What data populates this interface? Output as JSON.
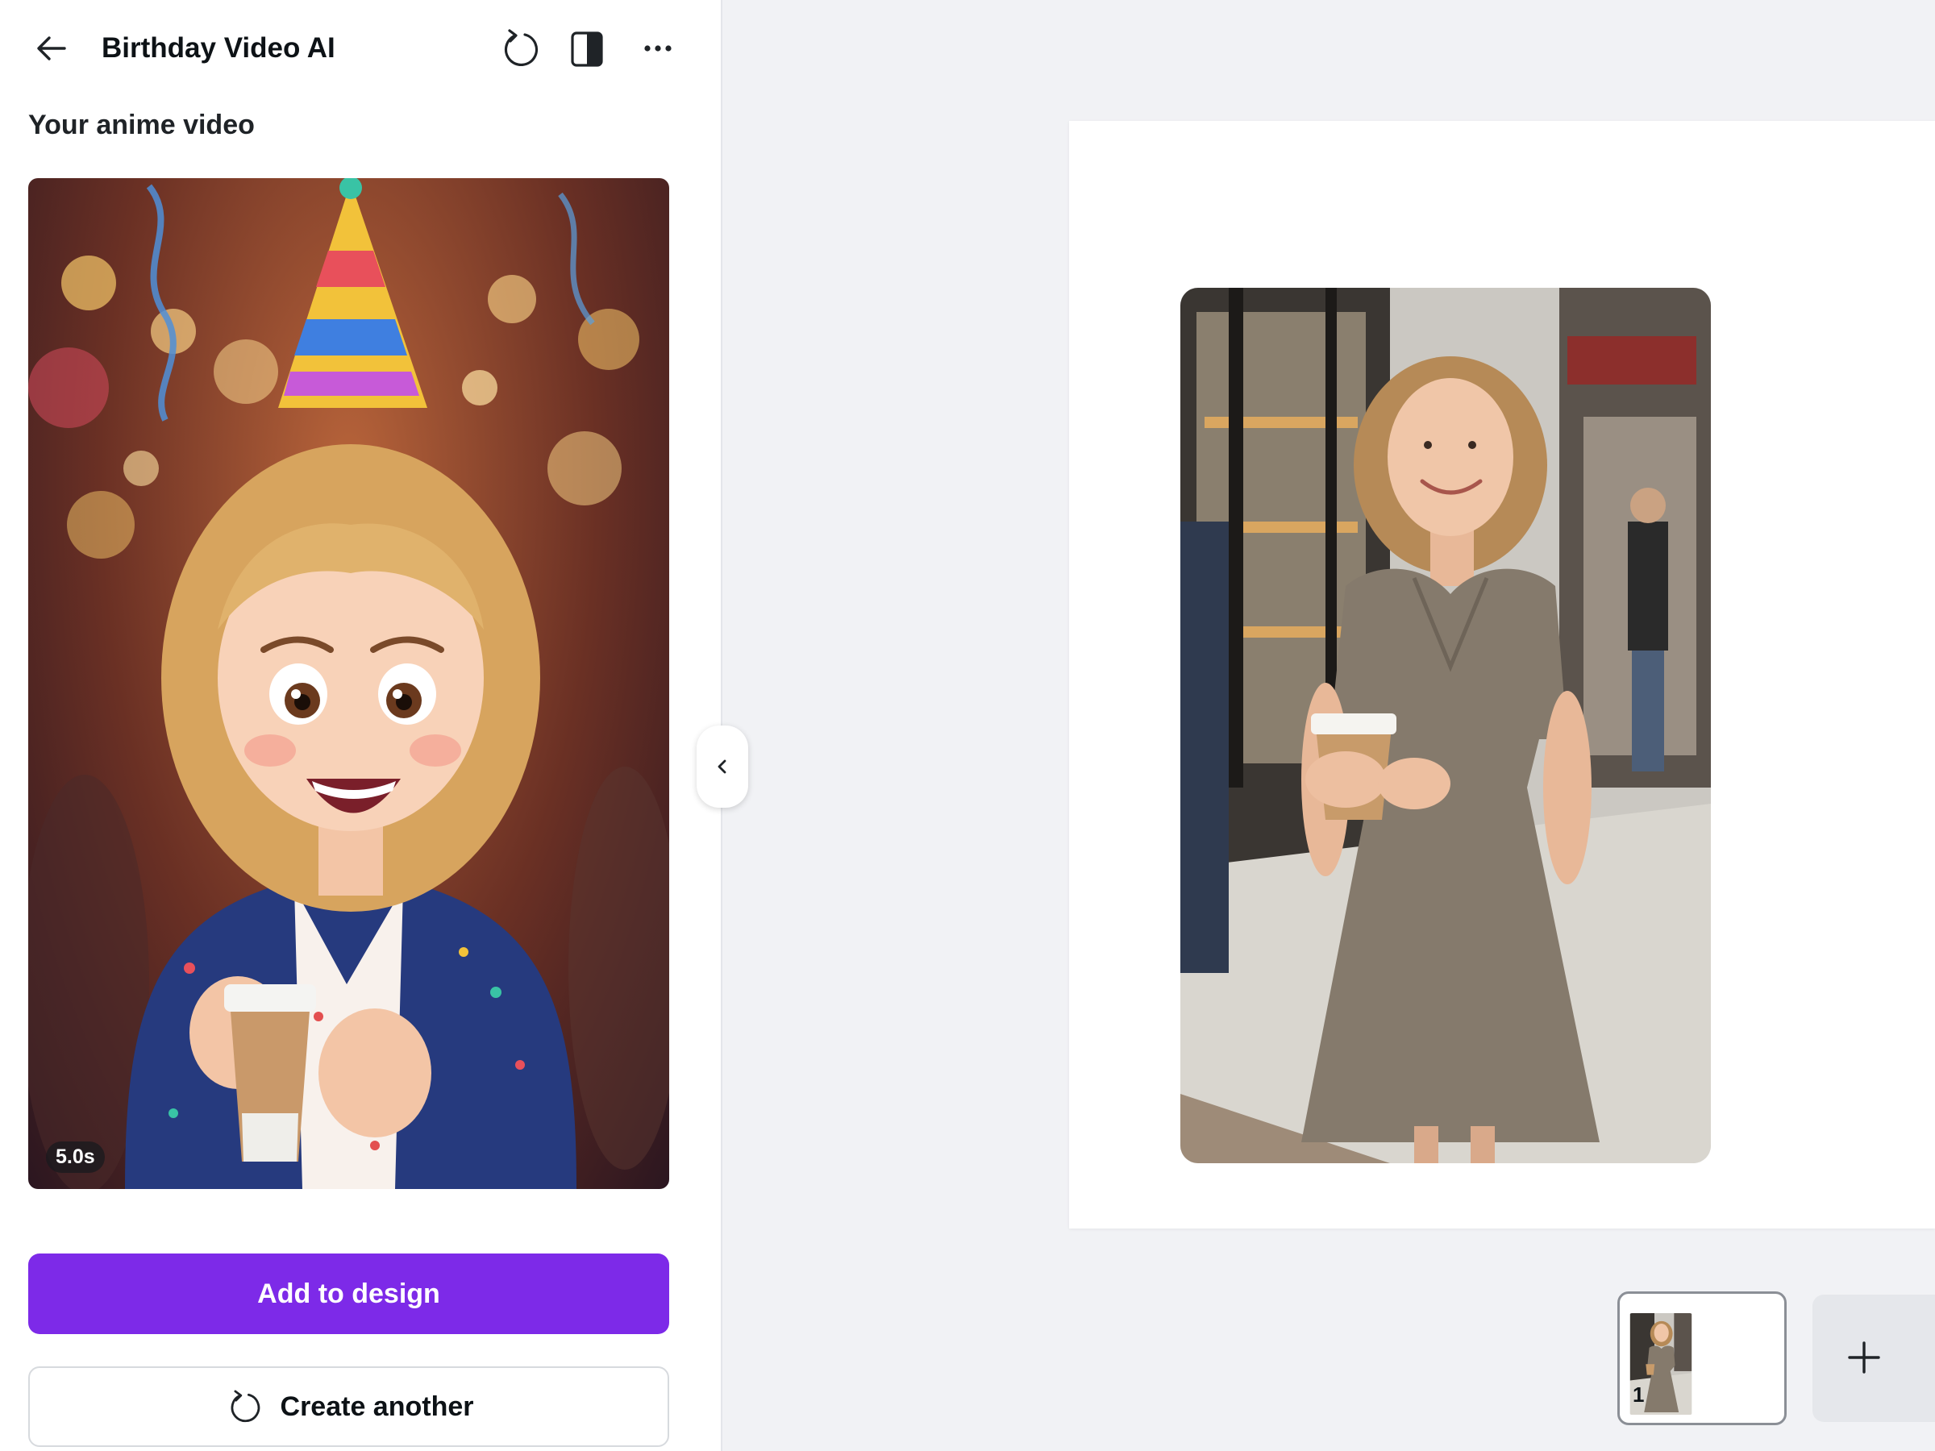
{
  "panel": {
    "title": "Birthday Video AI",
    "subtitle": "Your anime video",
    "video": {
      "duration": "5.0s"
    },
    "primary_button": "Add to design",
    "secondary_button": "Create another"
  },
  "icons": {
    "back": "arrow-left-icon",
    "refresh": "refresh-icon",
    "compare": "half-square-icon",
    "more": "more-horizontal-icon",
    "collapse": "chevron-left-icon",
    "add_page": "plus-icon"
  },
  "canvas": {
    "pages": [
      {
        "number": "1"
      }
    ]
  },
  "colors": {
    "accent": "#7d2ae8",
    "canvas_bg": "#f1f2f5",
    "panel_bg": "#ffffff"
  }
}
